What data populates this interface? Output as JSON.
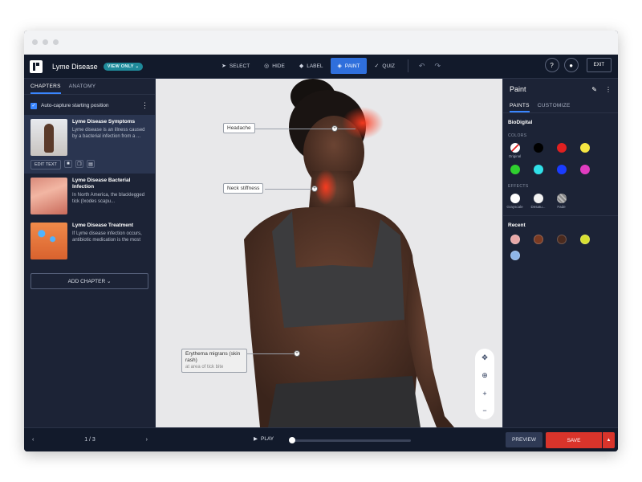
{
  "app": {
    "title": "Lyme Disease",
    "badge": "VIEW ONLY ⌄"
  },
  "toolbar": {
    "select": "SELECT",
    "hide": "HIDE",
    "label": "LABEL",
    "paint": "PAINT",
    "quiz": "QUIZ"
  },
  "topright": {
    "help": "?",
    "exit": "EXIT"
  },
  "left": {
    "tabs": [
      "CHAPTERS",
      "ANATOMY"
    ],
    "autocapture": "Auto-capture starting position",
    "chapters": [
      {
        "title": "Lyme Disease Symptoms",
        "desc": "Lyme disease is an illness caused by a bacterial infection from a ..."
      },
      {
        "title": "Lyme Disease Bacterial Infection",
        "desc": "In North America, the blacklegged tick (Ixodes scapu..."
      },
      {
        "title": "Lyme Disease Treatment",
        "desc": "If Lyme disease infection occurs, antibiotic medication is the most"
      }
    ],
    "edit_text": "EDIT TEXT",
    "add_chapter": "ADD CHAPTER ⌄"
  },
  "viewport": {
    "labels": {
      "headache": "Headache",
      "neck": "Neck stiffness",
      "rash_title": "Erythema migrans (skin rash)",
      "rash_sub": "at area of tick bite"
    }
  },
  "right": {
    "title": "Paint",
    "tabs": [
      "PAINTS",
      "CUSTOMIZE"
    ],
    "section": "BioDigital",
    "colors_title": "COLORS",
    "colors": [
      {
        "name": "Original",
        "hex": "#ffffff"
      },
      {
        "name": "",
        "hex": "#000000"
      },
      {
        "name": "",
        "hex": "#e02020"
      },
      {
        "name": "",
        "hex": "#f5e642"
      },
      {
        "name": "",
        "hex": "#2fd02f"
      },
      {
        "name": "",
        "hex": "#30e0e8"
      },
      {
        "name": "",
        "hex": "#1a3cff"
      },
      {
        "name": "",
        "hex": "#e03cc0"
      }
    ],
    "effects_title": "EFFECTS",
    "effects": [
      {
        "name": "Grayscale",
        "hex": "#ffffff"
      },
      {
        "name": "Desatu...",
        "hex": "#f2f2f2"
      },
      {
        "name": "Fade",
        "hex": "#9a9a9a"
      }
    ],
    "recent_title": "Recent",
    "recent": [
      "#e8a8a8",
      "#7a3a22",
      "#4a2a1e",
      "#d8e030",
      "#8fb6e8"
    ]
  },
  "bottom": {
    "page": "1 / 3",
    "play": "PLAY",
    "progress": 0.0,
    "preview": "PREVIEW",
    "save": "SAVE"
  }
}
